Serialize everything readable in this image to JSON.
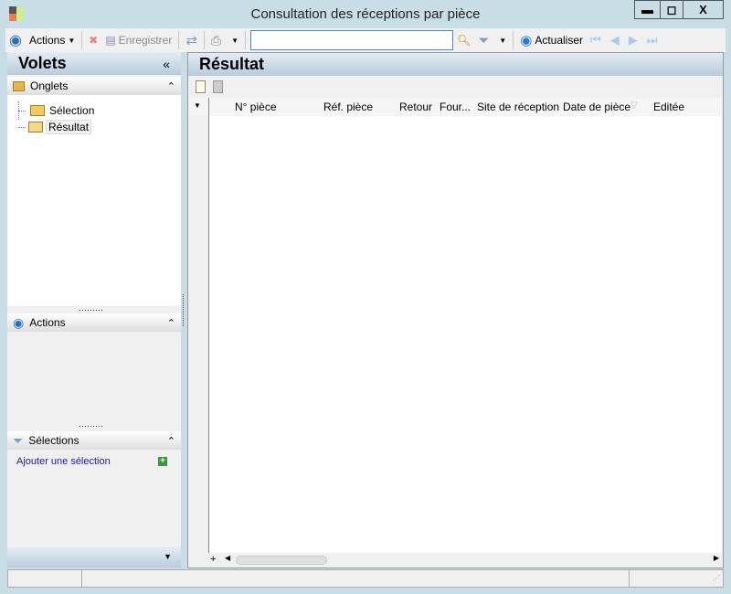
{
  "window": {
    "title": "Consultation des réceptions par pièce",
    "minimize": "—",
    "maximize": "☐",
    "close": "X"
  },
  "toolbar": {
    "actions": "Actions",
    "save": "Enregistrer",
    "search_value": "",
    "refresh": "Actualiser"
  },
  "left_panel": {
    "title": "Volets",
    "collapse": "«",
    "tabs_section": {
      "title": "Onglets",
      "items": [
        {
          "label": "Sélection"
        },
        {
          "label": "Résultat",
          "selected": true
        }
      ]
    },
    "actions_section": {
      "title": "Actions"
    },
    "selections_section": {
      "title": "Sélections",
      "add_link": "Ajouter une sélection"
    }
  },
  "result": {
    "title": "Résultat",
    "columns": [
      "N° pièce",
      "Réf. pièce",
      "Retour",
      "Four...",
      "Site de réception",
      "Date de pièce",
      "Editée"
    ]
  },
  "colors": {
    "accent": "#2a6ebd",
    "link": "#1a1aa6"
  }
}
